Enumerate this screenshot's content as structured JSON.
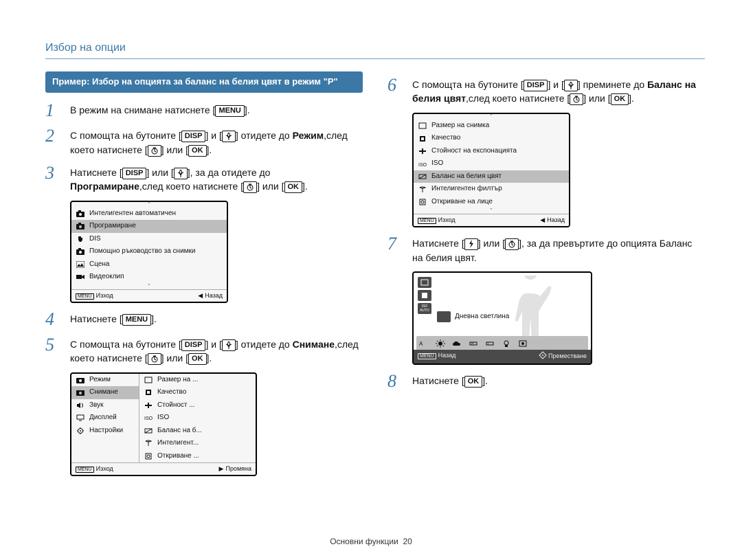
{
  "title": "Избор на опции",
  "footer": {
    "section": "Основни функции",
    "page": "20"
  },
  "example_heading": "Пример: Избор на опцията за баланс на белия цвят в режим \"P\"",
  "buttons": {
    "menu": "MENU",
    "disp": "DISP",
    "ok": "OK"
  },
  "steps": {
    "1": {
      "a": "В режим на снимане натиснете ",
      "b": "."
    },
    "2": {
      "a": "С помощта на бутоните ",
      "b": " и ",
      "c": " отидете до ",
      "d": "Режим",
      "e": ",след което натиснете ",
      "f": " или "
    },
    "3": {
      "a": "Натиснете ",
      "b": " или ",
      "c": ", за да отидете до ",
      "d": "Програмиране",
      "e": ",след което натиснете ",
      "f": " или "
    },
    "4": {
      "a": "Натиснете ",
      "b": "."
    },
    "5": {
      "a": "С помощта на бутоните ",
      "b": " и ",
      "c": " отидете до ",
      "d": "Снимане",
      "e": ",след което натиснете ",
      "f": " или "
    },
    "6": {
      "a": "С помощта на бутоните ",
      "b": " и ",
      "c": " преминете до ",
      "d": "Баланс на белия цвят",
      "e": ",след което натиснете ",
      "f": " или "
    },
    "7": {
      "a": "Натиснете ",
      "b": " или ",
      "c": ", за да превъртите до опцията Баланс на белия цвят."
    },
    "8": {
      "a": "Натиснете ",
      "b": "."
    }
  },
  "panel_mode": {
    "items": [
      "Интелигентен автоматичен",
      "Програмиране",
      "DIS",
      "Помощно ръководство за снимки",
      "Сцена",
      "Видеоклип"
    ],
    "selected_index": 1,
    "exit": "Изход",
    "back": "Назад"
  },
  "panel_menu": {
    "left": [
      {
        "label": "Режим"
      },
      {
        "label": "Снимане"
      },
      {
        "label": "Звук"
      },
      {
        "label": "Дисплей"
      },
      {
        "label": "Настройки"
      }
    ],
    "left_selected_index": 1,
    "right": [
      "Размер на ...",
      "Качество",
      "Стойност ...",
      "ISO",
      "Баланс на б...",
      "Интелигент...",
      "Откриване ..."
    ],
    "exit": "Изход",
    "change": "Промяна"
  },
  "panel_shoot": {
    "items": [
      "Размер на снимка",
      "Качество",
      "Стойност на експонацията",
      "ISO",
      "Баланс на белия цвят",
      "Интелигентен филтър",
      "Откриване на лице"
    ],
    "selected_index": 4,
    "exit": "Изход",
    "back": "Назад"
  },
  "panel_wb": {
    "selected_label": "Дневна светлина",
    "back": "Назад",
    "move": "Преместване"
  }
}
